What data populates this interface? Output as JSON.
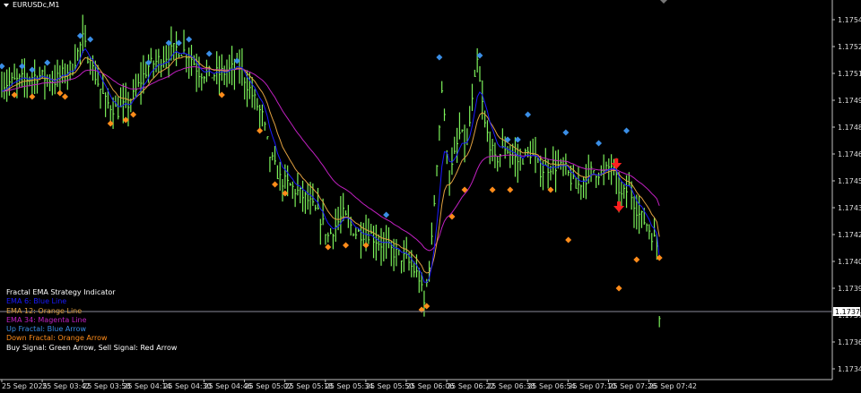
{
  "window": {
    "title": "EURUSDc,M1"
  },
  "legend": [
    {
      "text": "Fractal EMA Strategy Indicator",
      "color": "#ffffff"
    },
    {
      "text": "EMA 6: Blue Line",
      "color": "#1a1aff"
    },
    {
      "text": "EMA 12: Orange Line",
      "color": "#e0a040"
    },
    {
      "text": "EMA 34: Magenta Line",
      "color": "#c020c0"
    },
    {
      "text": "Up Fractal: Blue Arrow",
      "color": "#3a8ee6"
    },
    {
      "text": "Down Fractal: Orange Arrow",
      "color": "#ff8c1a"
    },
    {
      "text": "Buy Signal: Green Arrow, Sell Signal: Red Arrow",
      "color": "#ffffff"
    }
  ],
  "colors": {
    "bars": "#7cf05a",
    "ema6": "#1a1aff",
    "ema12": "#e0a040",
    "ema34": "#c020c0",
    "up_fractal": "#3a8ee6",
    "down_fractal": "#ff8c1a",
    "sell_signal": "#ff2020",
    "axis": "#c0c0c0"
  },
  "chart_data": {
    "type": "candlestick",
    "symbol": "EURUSDc",
    "timeframe": "M1",
    "x_tick_labels": [
      "25 Sep 2025",
      "25 Sep 03:42",
      "25 Sep 03:58",
      "25 Sep 04:14",
      "25 Sep 04:30",
      "25 Sep 04:46",
      "25 Sep 05:02",
      "25 Sep 05:18",
      "25 Sep 05:34",
      "25 Sep 05:50",
      "25 Sep 06:06",
      "25 Sep 06:22",
      "25 Sep 06:38",
      "25 Sep 06:54",
      "25 Sep 07:10",
      "25 Sep 07:26",
      "25 Sep 07:42"
    ],
    "y_tick_labels": [
      "1.17540",
      "1.17525",
      "1.17510",
      "1.17495",
      "1.17480",
      "1.17465",
      "1.17450",
      "1.17435",
      "1.17420",
      "1.17405",
      "1.17390",
      "1.17375",
      "1.17360",
      "1.17345"
    ],
    "ylim": [
      1.17337,
      1.17551
    ],
    "xlim": [
      "03:26",
      "07:55"
    ],
    "current_price": "1.17377",
    "close_series": [
      [
        "03:26",
        1.17504
      ],
      [
        "03:33",
        1.17506
      ],
      [
        "03:40",
        1.17509
      ],
      [
        "03:47",
        1.17506
      ],
      [
        "03:54",
        1.17514
      ],
      [
        "03:58",
        1.17529
      ],
      [
        "04:01",
        1.17516
      ],
      [
        "04:07",
        1.17494
      ],
      [
        "04:12",
        1.17489
      ],
      [
        "04:17",
        1.17494
      ],
      [
        "04:21",
        1.17506
      ],
      [
        "04:24",
        1.17514
      ],
      [
        "04:30",
        1.17519
      ],
      [
        "04:35",
        1.17524
      ],
      [
        "04:40",
        1.17521
      ],
      [
        "04:44",
        1.17511
      ],
      [
        "04:49",
        1.17509
      ],
      [
        "04:55",
        1.17511
      ],
      [
        "05:00",
        1.17514
      ],
      [
        "05:03",
        1.17504
      ],
      [
        "05:09",
        1.17486
      ],
      [
        "05:12",
        1.17464
      ],
      [
        "05:16",
        1.17451
      ],
      [
        "05:21",
        1.17446
      ],
      [
        "05:27",
        1.17439
      ],
      [
        "05:32",
        1.17429
      ],
      [
        "05:35",
        1.17419
      ],
      [
        "05:41",
        1.17431
      ],
      [
        "05:46",
        1.17421
      ],
      [
        "05:51",
        1.17421
      ],
      [
        "05:55",
        1.17416
      ],
      [
        "06:00",
        1.17411
      ],
      [
        "06:06",
        1.17406
      ],
      [
        "06:11",
        1.17396
      ],
      [
        "06:13",
        1.17381
      ],
      [
        "06:16",
        1.17416
      ],
      [
        "06:18",
        1.17461
      ],
      [
        "06:20",
        1.17501
      ],
      [
        "06:23",
        1.17451
      ],
      [
        "06:27",
        1.17476
      ],
      [
        "06:30",
        1.17471
      ],
      [
        "06:34",
        1.17516
      ],
      [
        "06:37",
        1.17481
      ],
      [
        "06:41",
        1.17461
      ],
      [
        "06:45",
        1.17469
      ],
      [
        "06:50",
        1.17461
      ],
      [
        "06:55",
        1.17466
      ],
      [
        "06:59",
        1.17456
      ],
      [
        "07:04",
        1.17459
      ],
      [
        "07:09",
        1.17456
      ],
      [
        "07:13",
        1.17446
      ],
      [
        "07:16",
        1.17451
      ],
      [
        "07:20",
        1.17456
      ],
      [
        "07:24",
        1.17454
      ],
      [
        "07:27",
        1.17459
      ],
      [
        "07:31",
        1.17441
      ],
      [
        "07:34",
        1.17446
      ],
      [
        "07:38",
        1.17431
      ],
      [
        "07:41",
        1.17426
      ],
      [
        "07:45",
        1.17414
      ],
      [
        "07:46",
        1.17376
      ]
    ],
    "up_fractals": [
      [
        "03:26",
        1.17514
      ],
      [
        "03:34",
        1.17514
      ],
      [
        "03:38",
        1.17512
      ],
      [
        "03:44",
        1.17516
      ],
      [
        "03:57",
        1.17531
      ],
      [
        "04:01",
        1.17529
      ],
      [
        "04:24",
        1.17516
      ],
      [
        "04:32",
        1.17527
      ],
      [
        "04:36",
        1.17527
      ],
      [
        "04:40",
        1.17529
      ],
      [
        "04:48",
        1.17521
      ],
      [
        "04:59",
        1.17517
      ],
      [
        "05:58",
        1.17431
      ],
      [
        "06:19",
        1.17519
      ],
      [
        "06:35",
        1.1752
      ],
      [
        "06:46",
        1.17473
      ],
      [
        "06:50",
        1.17473
      ],
      [
        "06:54",
        1.17487
      ],
      [
        "07:09",
        1.17477
      ],
      [
        "07:22",
        1.17471
      ],
      [
        "07:33",
        1.17478
      ]
    ],
    "down_fractals": [
      [
        "03:31",
        1.17498
      ],
      [
        "03:38",
        1.17497
      ],
      [
        "03:49",
        1.17499
      ],
      [
        "03:51",
        1.17497
      ],
      [
        "04:09",
        1.17482
      ],
      [
        "04:15",
        1.17484
      ],
      [
        "04:18",
        1.17487
      ],
      [
        "04:53",
        1.17498
      ],
      [
        "05:08",
        1.17478
      ],
      [
        "05:14",
        1.17448
      ],
      [
        "05:18",
        1.17443
      ],
      [
        "05:35",
        1.17413
      ],
      [
        "05:42",
        1.17414
      ],
      [
        "05:50",
        1.17414
      ],
      [
        "06:12",
        1.17378
      ],
      [
        "06:14",
        1.1738
      ],
      [
        "06:24",
        1.1743
      ],
      [
        "06:29",
        1.17445
      ],
      [
        "06:40",
        1.17445
      ],
      [
        "06:47",
        1.17445
      ],
      [
        "07:03",
        1.17445
      ],
      [
        "07:10",
        1.17417
      ],
      [
        "07:30",
        1.1739
      ],
      [
        "07:37",
        1.17406
      ],
      [
        "07:46",
        1.17407
      ]
    ],
    "sell_signals": [
      [
        "07:29",
        1.17459
      ],
      [
        "07:30",
        1.17435
      ]
    ]
  }
}
